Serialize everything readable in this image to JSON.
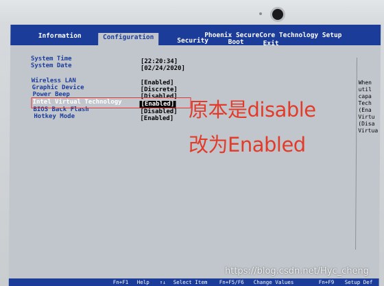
{
  "bios": {
    "title": "Phoenix SecureCore Technology Setup",
    "tabs": [
      {
        "label": "Information"
      },
      {
        "label": "Configuration"
      },
      {
        "label": "Security"
      },
      {
        "label": "Boot"
      },
      {
        "label": "Exit"
      }
    ],
    "active_tab": "Configuration",
    "system": [
      {
        "label": "System Time",
        "value": "[22:20:34]"
      },
      {
        "label": "System Date",
        "value": "[02/24/2020]"
      }
    ],
    "settings": [
      {
        "label": "Wireless LAN",
        "value": "[Enabled]"
      },
      {
        "label": "Graphic Device",
        "value": "[Discrete]"
      },
      {
        "label": "Power Beep",
        "value": "[Disabled]"
      },
      {
        "label": "Intel Virtual Technology",
        "value": "[Enabled]"
      },
      {
        "label": "BIOS Back Flash",
        "value": "[Disabled]"
      },
      {
        "label": "Hotkey Mode",
        "value": "[Enabled]"
      }
    ],
    "help_lines": [
      "When",
      "util",
      "capa",
      "Tech",
      "(Ena",
      "Virtu",
      "(Disa",
      "Virtua"
    ],
    "footer": {
      "f1": "Fn+F1",
      "help": "Help",
      "arrows": "↑↓",
      "select_item": "Select Item",
      "f5f6": "Fn+F5/F6",
      "change_values": "Change Values",
      "f9": "Fn+F9",
      "setup_defaults": "Setup Def"
    }
  },
  "annotation": {
    "line1": "原本是disable",
    "line2": "改为Enabled"
  },
  "watermark": "https://blog.csdn.net/Hyc_cheng",
  "colors": {
    "bios_blue": "#1c3c9a",
    "bios_gray": "#c0c6cc",
    "annotation_red": "#e23b2a"
  }
}
